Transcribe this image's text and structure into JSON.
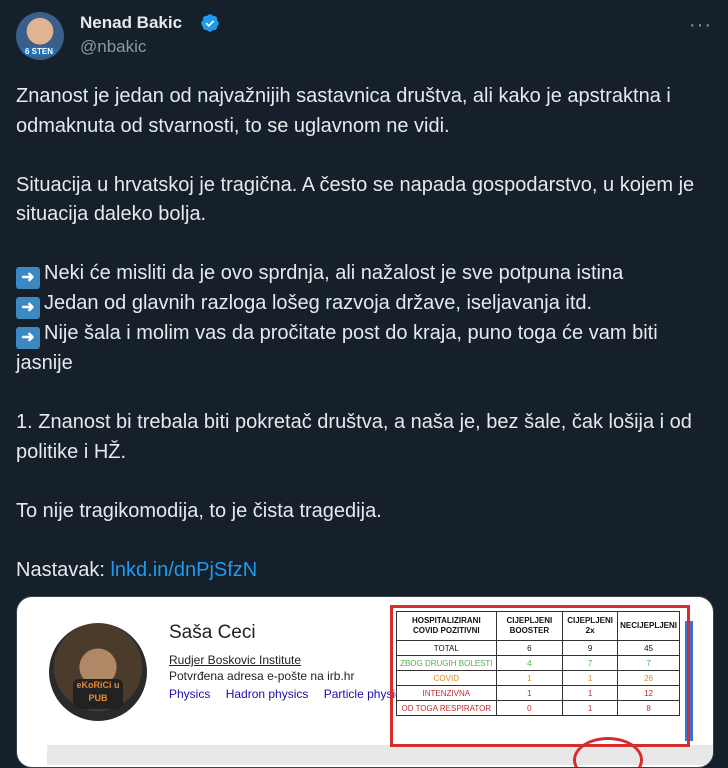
{
  "author": {
    "name": "Nenad Bakic",
    "handle": "@nbakic",
    "avatar_badge": "6 STEN"
  },
  "more_label": "···",
  "tweet": {
    "p1": "Znanost je jedan od najvažnijih sastavnica društva, ali kako je apstraktna i odmaknuta od stvarnosti, to se uglavnom ne vidi.",
    "p2": "Situacija u hrvatskoj je tragična. A često se napada gospodarstvo, u kojem je situacija daleko bolja.",
    "bullets": [
      "Neki će misliti da je ovo sprdnja, ali nažalost je sve potpuna istina",
      "Jedan od glavnih razloga lošeg razvoja države, iseljavanja itd.",
      "Nije šala i molim vas da pročitate post do kraja, puno toga će vam biti jasnije"
    ],
    "p4": "1. Znanost bi trebala biti pokretač društva, a naša je, bez šale, čak lošija i od politike i HŽ.",
    "p5": "To nije tragikomodija, to je čista tragedija.",
    "continuation_label": "Nastavak: ",
    "continuation_link": "lnkd.in/dnPjSfzN"
  },
  "card": {
    "name": "Saša Ceci",
    "institution": "Rudjer Boskovic Institute",
    "email": "Potvrđena adresa e-pošte na irb.hr",
    "tags": [
      "Physics",
      "Hadron physics",
      "Particle physics"
    ],
    "shirt_text": "eKoRiCi u PUB",
    "table": {
      "headers": [
        "HOSPITALIZIRANI COVID POZITIVNI",
        "CIJEPLJENI BOOSTER",
        "CIJEPLJENI 2x",
        "NECIJEPLJENI"
      ],
      "rows": [
        {
          "label": "TOTAL",
          "values": [
            "6",
            "9",
            "45"
          ],
          "color": "black"
        },
        {
          "label": "ZBOG DRUGIH BOLESTI",
          "values": [
            "4",
            "7",
            "7"
          ],
          "color": "green"
        },
        {
          "label": "COVID",
          "values": [
            "1",
            "1",
            "26"
          ],
          "color": "orange"
        },
        {
          "label": "INTENZIVNA",
          "values": [
            "1",
            "1",
            "12"
          ],
          "color": "red"
        },
        {
          "label": "OD TOGA RESPIRATOR",
          "values": [
            "0",
            "1",
            "8"
          ],
          "color": "red"
        }
      ]
    }
  },
  "colors": {
    "background": "#15202b",
    "text": "#e7e9ea",
    "secondary": "#8b98a5",
    "link": "#1d9bf0",
    "highlight_box": "#d32f2f"
  }
}
